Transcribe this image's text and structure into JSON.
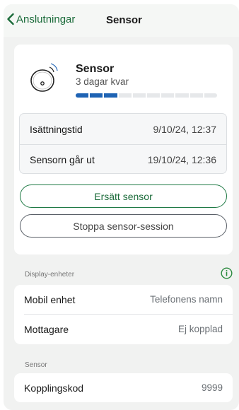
{
  "nav": {
    "back_label": "Anslutningar",
    "title": "Sensor"
  },
  "sensor": {
    "name": "Sensor",
    "remaining": "3 dagar kvar",
    "remaining_fraction": 0.3,
    "insertion_label": "Isättningstid",
    "insertion_value": "9/10/24, 12:37",
    "expiry_label": "Sensorn går ut",
    "expiry_value": "19/10/24, 12:36",
    "replace_button": "Ersätt sensor",
    "stop_button": "Stoppa sensor-session"
  },
  "display_devices": {
    "header": "Display-enheter",
    "rows": [
      {
        "label": "Mobil enhet",
        "value": "Telefonens namn"
      },
      {
        "label": "Mottagare",
        "value": "Ej kopplad"
      }
    ]
  },
  "sensor_section": {
    "header": "Sensor",
    "rows": [
      {
        "label": "Kopplingskod",
        "value": "9999"
      }
    ]
  },
  "colors": {
    "accent_green": "#1b6b3a",
    "progress_blue": "#1e63b4"
  }
}
